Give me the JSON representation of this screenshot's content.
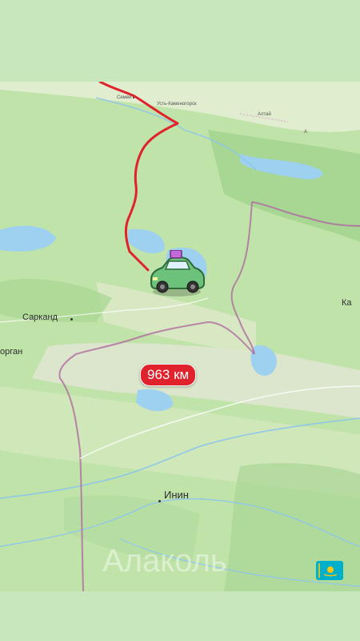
{
  "map": {
    "route_distance": "963 км",
    "watermark_text": "Алаколь",
    "places": {
      "semey": "Семей",
      "ust_kamenogorsk": "Усть-Каменогорск",
      "altai": "Алтай",
      "sarkand": "Сарканд",
      "taldykorgan_partial": "орган",
      "yining": "Инин",
      "edge_right": "Ка",
      "edge_top_right": "А"
    },
    "icons": {
      "vehicle": "car-icon",
      "flag": "kazakhstan-flag-icon"
    },
    "colors": {
      "route": "#e0222c",
      "border": "#b06aa0",
      "water": "#9ed0f0"
    }
  }
}
